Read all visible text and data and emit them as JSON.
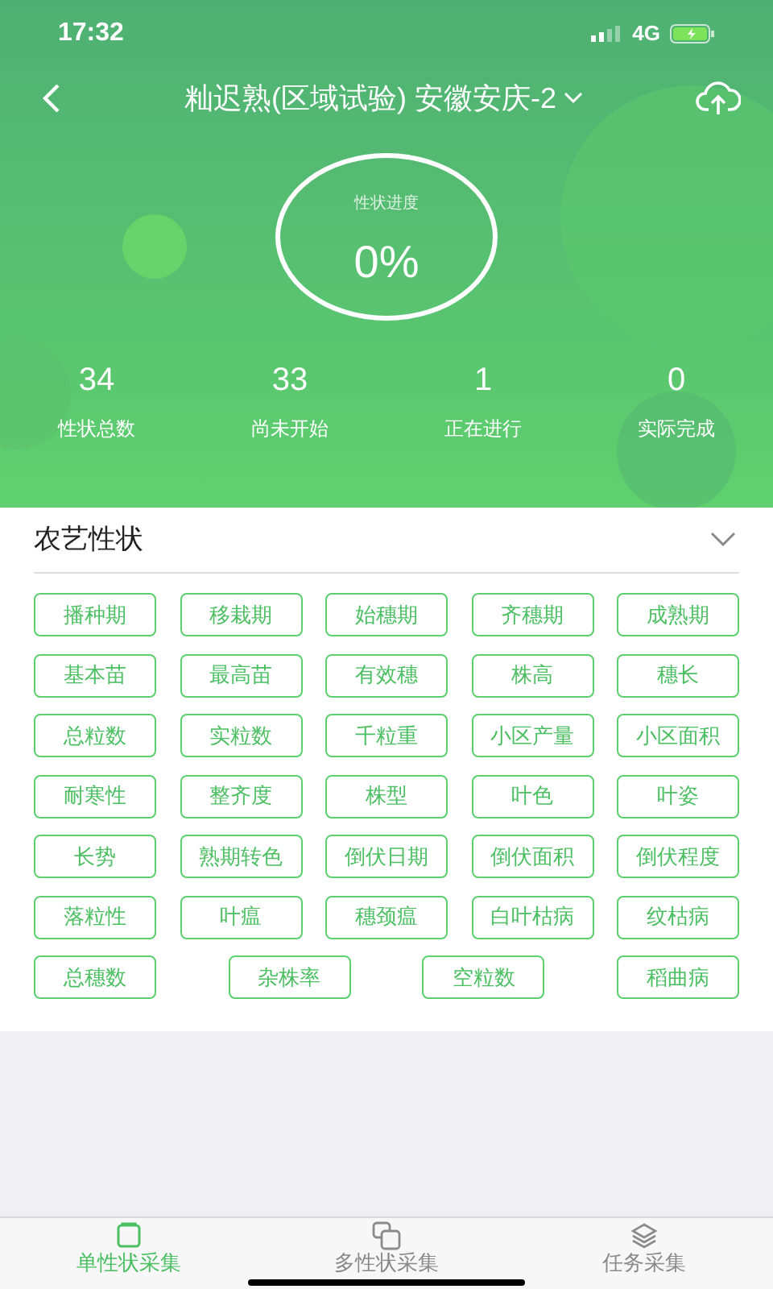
{
  "status_bar": {
    "time": "17:32",
    "network": "4G"
  },
  "header": {
    "title": "籼迟熟(区域试验) 安徽安庆-2"
  },
  "progress": {
    "label": "性状进度",
    "value": "0%"
  },
  "stats": [
    {
      "value": "34",
      "label": "性状总数"
    },
    {
      "value": "33",
      "label": "尚未开始"
    },
    {
      "value": "1",
      "label": "正在进行"
    },
    {
      "value": "0",
      "label": "实际完成"
    }
  ],
  "section": {
    "title": "农艺性状",
    "expanded": true,
    "tags": [
      "播种期",
      "移栽期",
      "始穗期",
      "齐穗期",
      "成熟期",
      "基本苗",
      "最高苗",
      "有效穗",
      "株高",
      "穗长",
      "总粒数",
      "实粒数",
      "千粒重",
      "小区产量",
      "小区面积",
      "耐寒性",
      "整齐度",
      "株型",
      "叶色",
      "叶姿",
      "长势",
      "熟期转色",
      "倒伏日期",
      "倒伏面积",
      "倒伏程度",
      "落粒性",
      "叶瘟",
      "穗颈瘟",
      "白叶枯病",
      "纹枯病",
      "总穗数",
      "杂株率",
      "空粒数",
      "稻曲病"
    ]
  },
  "tabs": [
    {
      "label": "单性状采集",
      "selected": true,
      "kind": "single"
    },
    {
      "label": "多性状采集",
      "selected": false,
      "kind": "multi"
    },
    {
      "label": "任务采集",
      "selected": false,
      "kind": "task"
    }
  ]
}
